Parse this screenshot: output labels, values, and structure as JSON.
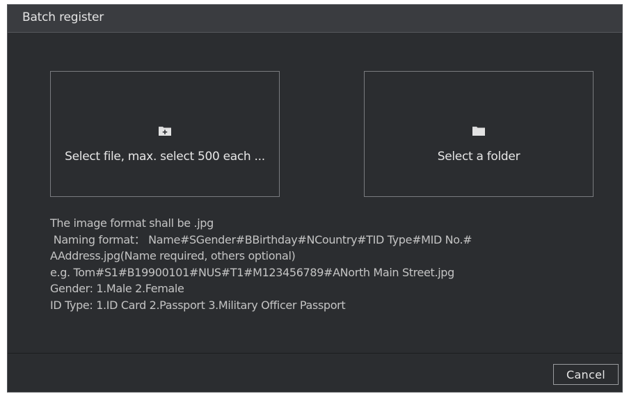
{
  "dialog": {
    "title": "Batch register"
  },
  "options": {
    "file_label": "Select file, max. select 500 each ...",
    "file_icon": "add-file-icon",
    "folder_label": "Select a folder",
    "folder_icon": "folder-icon"
  },
  "info": {
    "lines": [
      "The image format shall be  .jpg",
      " Naming format： Name#SGender#BBirthday#NCountry#TID Type#MID No.#",
      "AAddress.jpg(Name required, others optional)",
      "e.g. Tom#S1#B19900101#NUS#T1#M123456789#ANorth Main Street.jpg",
      "Gender: 1.Male 2.Female",
      "ID Type: 1.ID Card 2.Passport 3.Military Officer Passport"
    ]
  },
  "footer": {
    "cancel_label": "Cancel"
  },
  "colors": {
    "background": "#2b2d30",
    "title_bar": "#3a3c40",
    "text": "#e6e6e6",
    "muted_text": "#c4c4c4",
    "border": "#7a7c80"
  }
}
